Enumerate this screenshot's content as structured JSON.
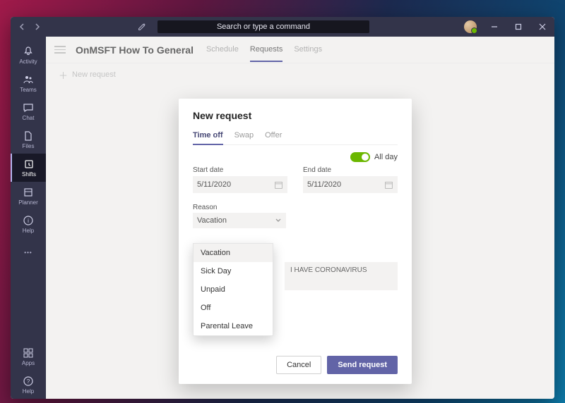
{
  "titlebar": {
    "search_placeholder": "Search or type a command"
  },
  "rail": {
    "items": [
      {
        "label": "Activity"
      },
      {
        "label": "Teams"
      },
      {
        "label": "Chat"
      },
      {
        "label": "Files"
      },
      {
        "label": "Shifts"
      },
      {
        "label": "Planner"
      },
      {
        "label": "Help"
      }
    ],
    "bottom": [
      {
        "label": "Apps"
      },
      {
        "label": "Help"
      }
    ]
  },
  "header": {
    "title": "OnMSFT How To General",
    "tabs": [
      "Schedule",
      "Requests",
      "Settings"
    ],
    "active_tab": "Requests",
    "new_request": "New request"
  },
  "modal": {
    "title": "New request",
    "tabs": [
      "Time off",
      "Swap",
      "Offer"
    ],
    "active_tab": "Time off",
    "all_day_label": "All day",
    "all_day_on": true,
    "start_date": {
      "label": "Start date",
      "value": "5/11/2020"
    },
    "end_date": {
      "label": "End date",
      "value": "5/11/2020"
    },
    "reason": {
      "label": "Reason",
      "selected": "Vacation",
      "options": [
        "Vacation",
        "Sick Day",
        "Unpaid",
        "Off",
        "Parental Leave"
      ]
    },
    "note_value": "I HAVE CORONAVIRUS",
    "cancel": "Cancel",
    "send": "Send request"
  },
  "colors": {
    "accent": "#6264a7",
    "toggle_on": "#6bb700"
  }
}
